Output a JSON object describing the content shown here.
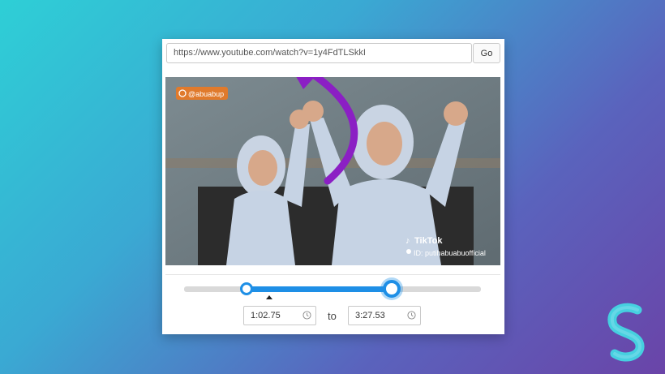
{
  "url_bar": {
    "value": "https://www.youtube.com/watch?v=1y4FdTLSkkI",
    "go_label": "Go"
  },
  "video": {
    "watermark_handle": "@abuabup",
    "tiktok_label": "TikTok",
    "tiktok_id": "ID: putihabuabuofficial"
  },
  "range": {
    "start_fraction": 0.21,
    "end_fraction": 0.7,
    "start_time": "1:02.75",
    "end_time": "3:27.53",
    "separator": "to"
  },
  "colors": {
    "accent": "#1e8fe6",
    "arrow": "#8b1fc4"
  },
  "icons": {
    "clock": "clock-icon",
    "tiktok": "tiktok-note-icon",
    "instagram": "instagram-icon",
    "user": "user-icon",
    "brand": "s-logo-icon"
  }
}
